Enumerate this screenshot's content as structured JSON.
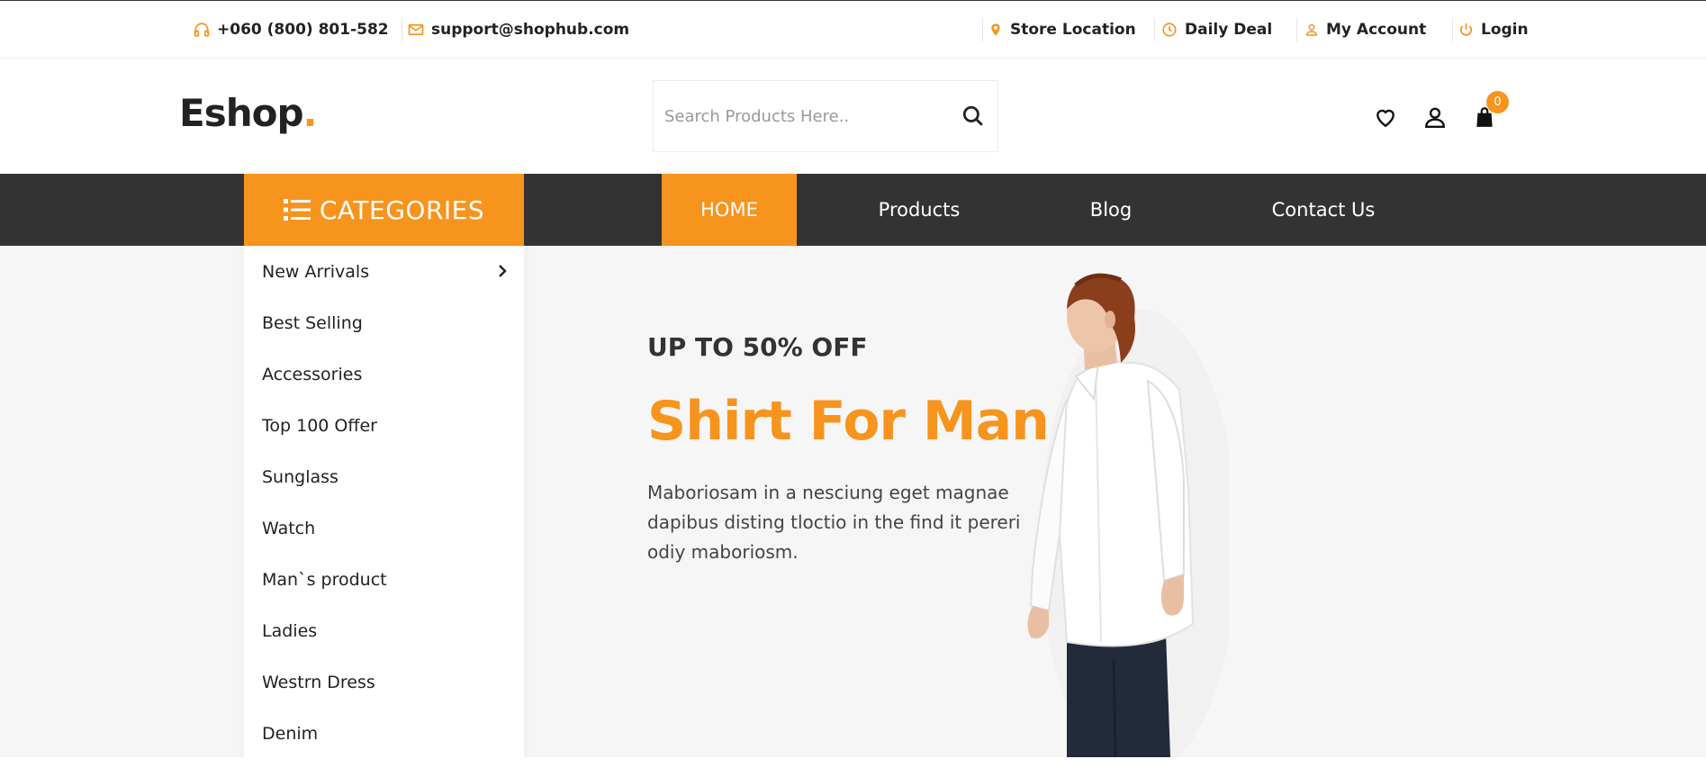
{
  "topbar": {
    "phone": "+060 (800) 801-582",
    "email": "support@shophub.com",
    "store_location": "Store Location",
    "daily_deal": "Daily Deal",
    "my_account": "My Account",
    "login": "Login"
  },
  "header": {
    "logo_text": "Eshop",
    "logo_dot": ".",
    "search_placeholder": "Search Products Here..",
    "cart_count": "0"
  },
  "nav": {
    "categories_label": "CATEGORIES",
    "links": [
      "HOME",
      "Products",
      "Blog",
      "Contact Us"
    ],
    "active": "HOME"
  },
  "categories": [
    "New Arrivals",
    "Best Selling",
    "Accessories",
    "Top 100 Offer",
    "Sunglass",
    "Watch",
    "Man`s product",
    "Ladies",
    "Westrn Dress",
    "Denim"
  ],
  "hero": {
    "subtitle": "UP TO 50% OFF",
    "title": "Shirt For Man",
    "text": "Maboriosam in a nesciung eget magnae dapibus disting tloctio in the find it pereri odiy maboriosm."
  },
  "colors": {
    "accent": "#f7941d",
    "nav_bg": "#333333",
    "hero_bg": "#f6f6f6"
  },
  "icons": {
    "phone": "headphones-icon",
    "email": "envelope-icon",
    "store": "map-pin-icon",
    "deal": "clock-icon",
    "account": "user-icon",
    "login": "power-icon",
    "search": "search-icon",
    "wishlist": "heart-icon",
    "profile": "user-icon",
    "cart": "shopping-bag-icon",
    "categories": "list-icon",
    "submenu": "chevron-right-icon"
  }
}
